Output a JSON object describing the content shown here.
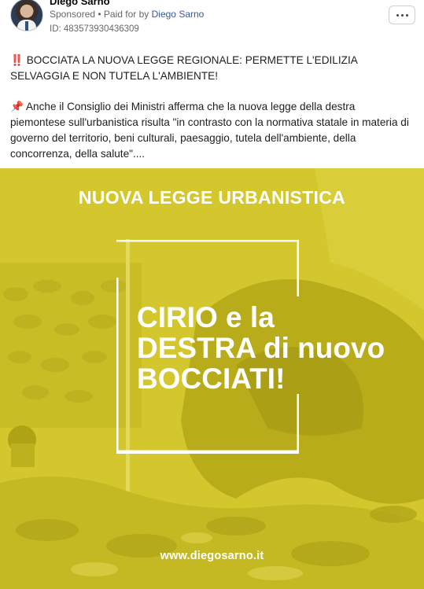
{
  "post": {
    "page_name": "Diego Sarno",
    "sponsored": "Sponsored",
    "paid_for_prefix": " • Paid for by ",
    "payer": "Diego Sarno",
    "ad_id": "ID: 483573930436309",
    "text_line1": "‼️ BOCCIATA LA NUOVA LEGGE REGIONALE: PERMETTE L'EDILIZIA SELVAGGIA E NON TUTELA L'AMBIENTE!",
    "pin_icon": "📌",
    "text_line2": " Anche il Consiglio dei Ministri afferma che la nuova legge della destra piemontese sull'urbanistica risulta \"in contrasto con la normativa statale in materia di governo del territorio, beni culturali, paesaggio, tutela dell'ambiente, della concorrenza, della salute\"...."
  },
  "creative": {
    "headline": "NUOVA LEGGE URBANISTICA",
    "slogan_line1": "CIRIO e la",
    "slogan_line2": "DESTRA di nuovo",
    "slogan_line3": "BOCCIATI!",
    "website": "www.diegosarno.it",
    "accent_color": "#d2c62c"
  }
}
